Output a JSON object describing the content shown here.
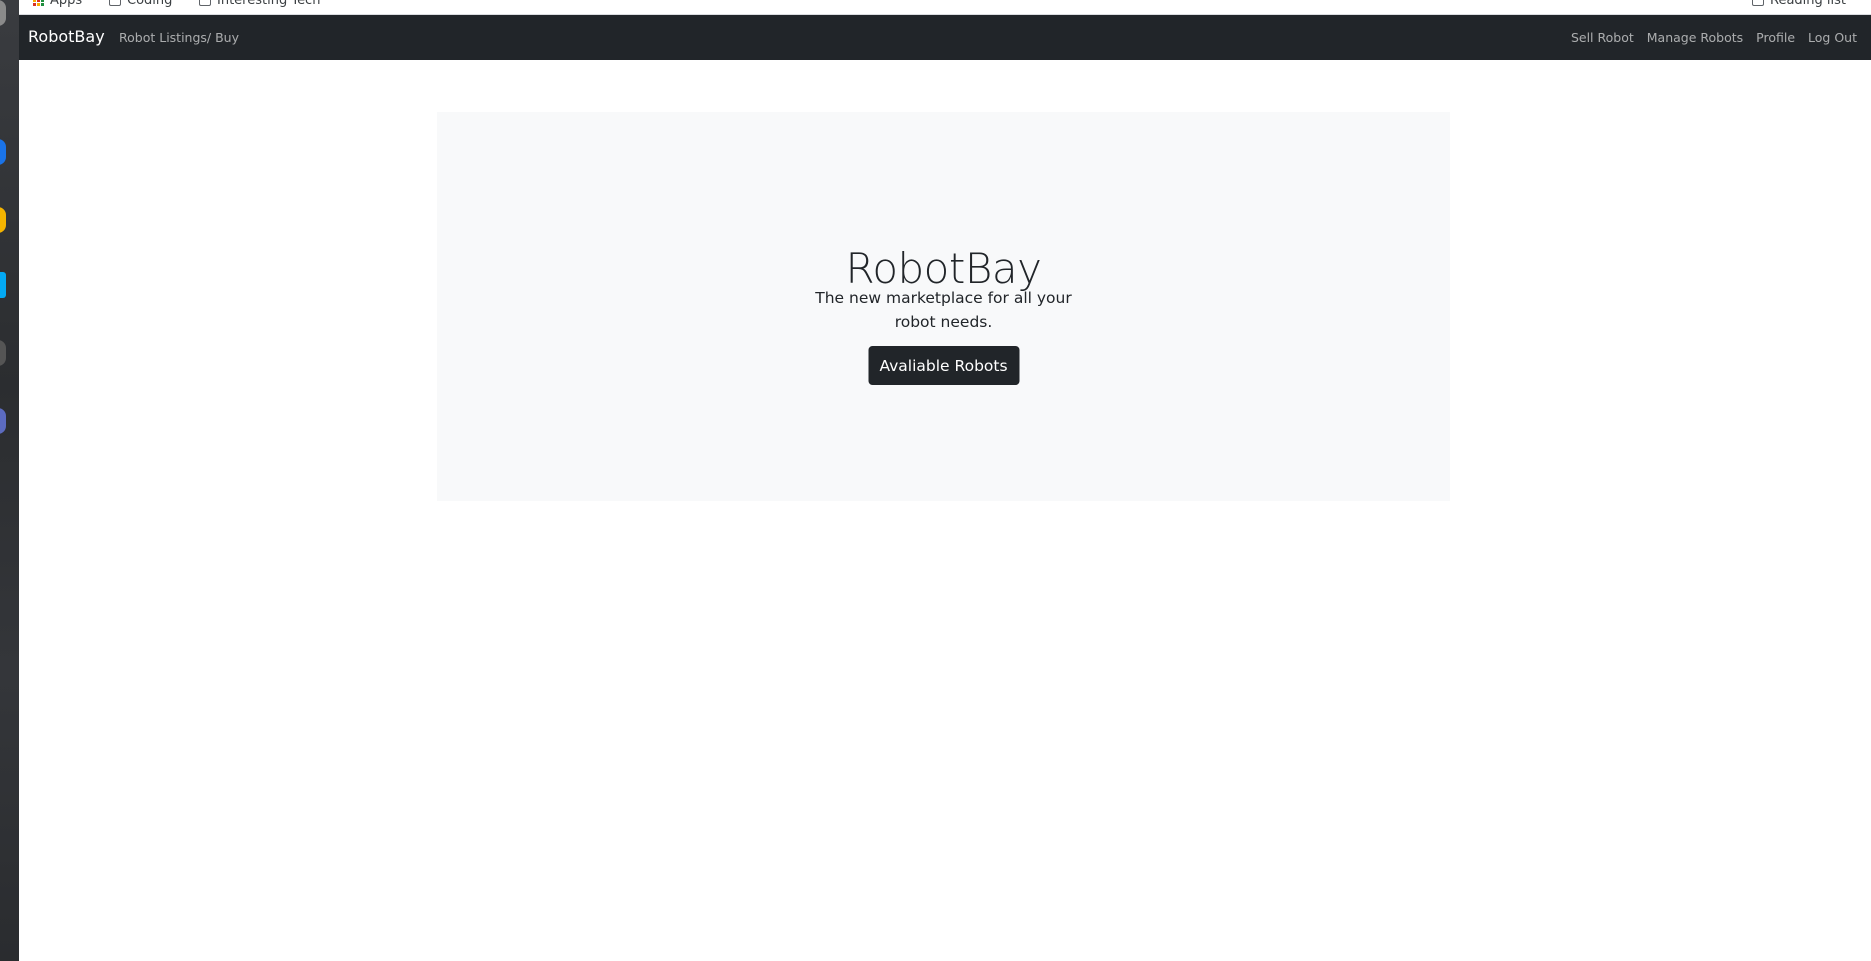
{
  "bookmarks": {
    "items": [
      {
        "label": "Apps"
      },
      {
        "label": "Coding"
      },
      {
        "label": "Interesting Tech"
      }
    ],
    "reading_list": "Reading list"
  },
  "navbar": {
    "brand": "RobotBay",
    "left_links": [
      "Robot Listings/ Buy"
    ],
    "right_links": [
      "Sell Robot",
      "Manage Robots",
      "Profile",
      "Log Out"
    ]
  },
  "hero": {
    "title": "RobotBay",
    "subtitle": "The new marketplace for all your robot needs.",
    "button_label": "Avaliable Robots"
  },
  "colors": {
    "navbar_bg": "#212529",
    "hero_bg": "#f8f9fa",
    "button_bg": "#212529",
    "text_primary": "#212529"
  }
}
